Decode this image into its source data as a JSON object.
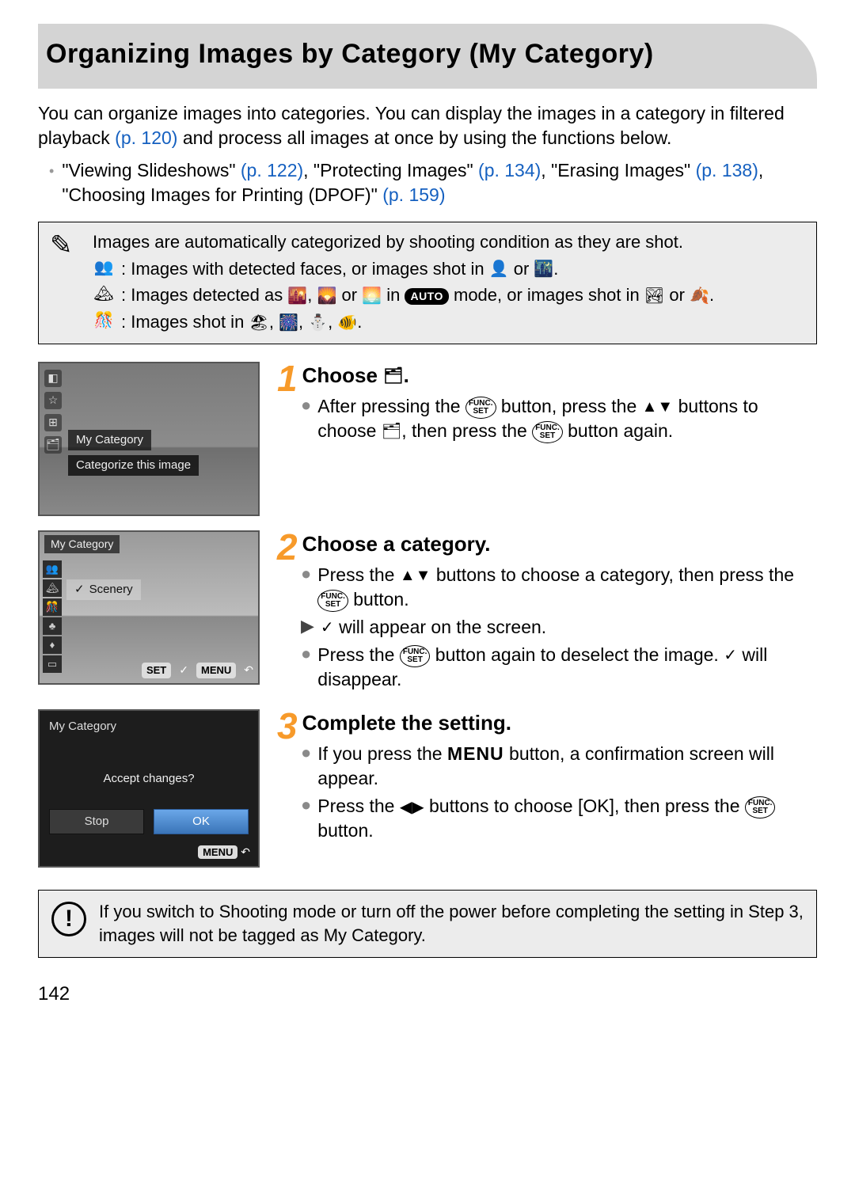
{
  "header": {
    "title": "Organizing Images by Category (My Category)"
  },
  "intro": {
    "text1": "You can organize images into categories. You can display the images in a category in filtered playback ",
    "ref1": "(p. 120)",
    "text2": " and process all images at once by using the functions below."
  },
  "refs": {
    "a": "\"Viewing Slideshows\" ",
    "ap": "(p. 122)",
    "b": ", \"Protecting Images\" ",
    "bp": "(p. 134)",
    "c": ", \"Erasing Images\" ",
    "cp": "(p. 138)",
    "d": ", \"Choosing Images for Printing (DPOF)\" ",
    "dp": "(p. 159)"
  },
  "note": {
    "lead": "Images are automatically categorized by shooting condition as they are shot.",
    "l1a": ": Images with detected faces, or images shot in ",
    "l1b": " or ",
    "l1c": ".",
    "l2a": ": Images detected as ",
    "l2b": ", ",
    "l2c": " or ",
    "l2d": " in ",
    "auto": "AUTO",
    "l2e": " mode, or images shot in ",
    "l2f": " or ",
    "l2g": ".",
    "l3a": ": Images shot in ",
    "l3b": ", ",
    "l3c": ", ",
    "l3d": ", ",
    "l3e": "."
  },
  "steps": {
    "s1": {
      "num": "1",
      "title_a": "Choose ",
      "title_b": ".",
      "b1a": "After pressing the ",
      "b1b": " button, press the ",
      "b1c": " buttons to choose ",
      "b1d": ", then press the ",
      "b1e": " button again."
    },
    "s2": {
      "num": "2",
      "title": "Choose a category.",
      "b1a": "Press the ",
      "b1b": " buttons to choose a category, then press the ",
      "b1c": " button.",
      "b2a": " will appear on the screen.",
      "b3a": "Press the ",
      "b3b": " button again to deselect the image. ",
      "b3c": " will disappear."
    },
    "s3": {
      "num": "3",
      "title": "Complete the setting.",
      "b1a": "If you press the ",
      "menu": "MENU",
      "b1b": " button, a confirmation screen will appear.",
      "b2a": "Press the ",
      "b2b": " buttons to choose [OK], then press the ",
      "b2c": " button."
    }
  },
  "screens": {
    "s1": {
      "label1": "My Category",
      "label2": "Categorize this image"
    },
    "s2": {
      "title": "My Category",
      "item": "Scenery",
      "set": "SET",
      "menu": "MENU"
    },
    "s3": {
      "title": "My Category",
      "prompt": "Accept changes?",
      "stop": "Stop",
      "ok": "OK",
      "menu": "MENU"
    }
  },
  "warn": "If you switch to Shooting mode or turn off the power before completing the setting in Step 3, images will not be tagged as My Category.",
  "func": {
    "top": "FUNC.",
    "bot": "SET"
  },
  "page": "142"
}
